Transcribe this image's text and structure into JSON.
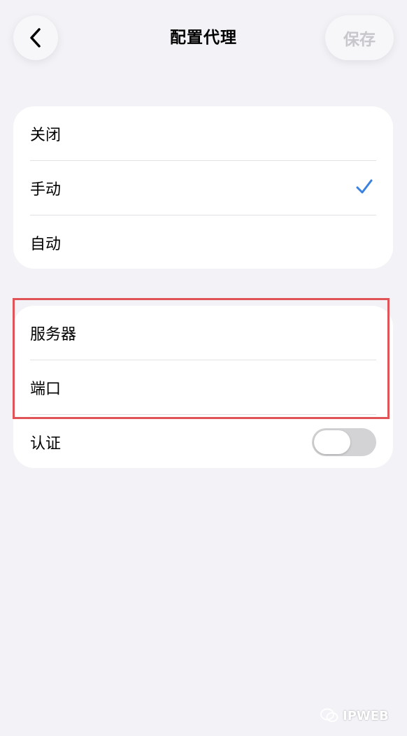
{
  "header": {
    "title": "配置代理",
    "save_label": "保存"
  },
  "mode_options": [
    {
      "label": "关闭"
    },
    {
      "label": "手动"
    },
    {
      "label": "自动"
    }
  ],
  "selected_mode": "手动",
  "proxy_fields": {
    "server_label": "服务器",
    "port_label": "端口",
    "auth_label": "认证"
  },
  "auth_enabled": false,
  "watermark": {
    "text": "IPWEB"
  },
  "colors": {
    "accent": "#3b82e0",
    "highlight": "#e05458",
    "background": "#f2f2f7"
  }
}
